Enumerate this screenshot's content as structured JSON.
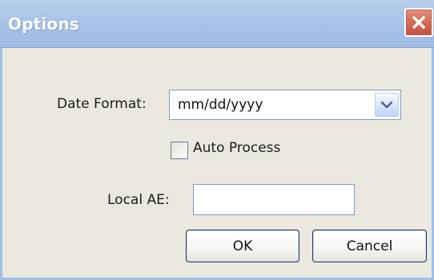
{
  "window": {
    "title": "Options",
    "close_icon": "close-icon"
  },
  "form": {
    "date_format": {
      "label": "Date Format:",
      "value": "mm/dd/yyyy",
      "dropdown_icon": "chevron-down-icon"
    },
    "auto_process": {
      "label": "Auto Process",
      "checked": false
    },
    "local_ae": {
      "label": "Local AE:",
      "value": ""
    }
  },
  "buttons": {
    "ok": "OK",
    "cancel": "Cancel"
  },
  "colors": {
    "titlebar": "#a9c3e8",
    "dialog_bg": "#ebe9df",
    "close_button": "#d66a56"
  }
}
